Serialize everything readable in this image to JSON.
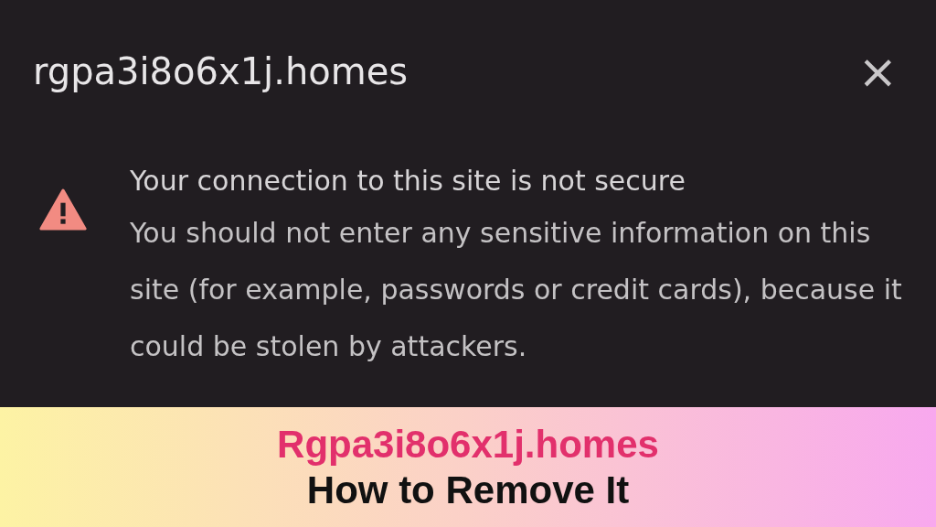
{
  "dialog": {
    "title": "rgpa3i8o6x1j.homes",
    "close": "×",
    "heading": "Your connection to this site is not secure",
    "message": "You should not enter any sensitive information on this site (for example, passwords or credit cards), because it could be stolen by attackers."
  },
  "banner": {
    "title": "Rgpa3i8o6x1j.homes",
    "subtitle": "How to Remove It"
  }
}
